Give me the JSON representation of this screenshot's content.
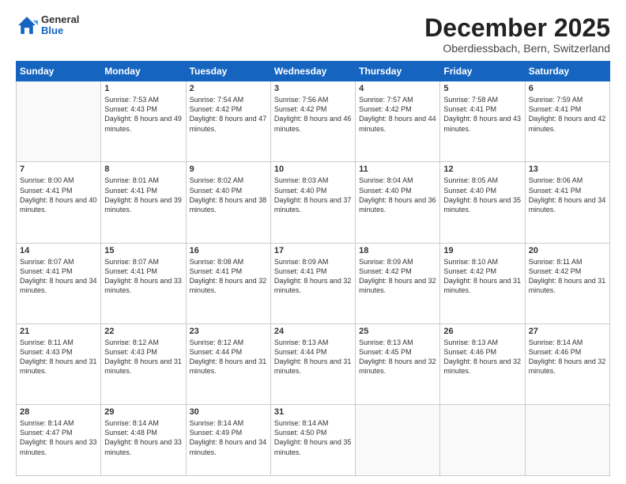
{
  "logo": {
    "general": "General",
    "blue": "Blue"
  },
  "header": {
    "month": "December 2025",
    "location": "Oberdiessbach, Bern, Switzerland"
  },
  "weekdays": [
    "Sunday",
    "Monday",
    "Tuesday",
    "Wednesday",
    "Thursday",
    "Friday",
    "Saturday"
  ],
  "weeks": [
    [
      {
        "day": "",
        "sunrise": "",
        "sunset": "",
        "daylight": ""
      },
      {
        "day": "1",
        "sunrise": "Sunrise: 7:53 AM",
        "sunset": "Sunset: 4:43 PM",
        "daylight": "Daylight: 8 hours and 49 minutes."
      },
      {
        "day": "2",
        "sunrise": "Sunrise: 7:54 AM",
        "sunset": "Sunset: 4:42 PM",
        "daylight": "Daylight: 8 hours and 47 minutes."
      },
      {
        "day": "3",
        "sunrise": "Sunrise: 7:56 AM",
        "sunset": "Sunset: 4:42 PM",
        "daylight": "Daylight: 8 hours and 46 minutes."
      },
      {
        "day": "4",
        "sunrise": "Sunrise: 7:57 AM",
        "sunset": "Sunset: 4:42 PM",
        "daylight": "Daylight: 8 hours and 44 minutes."
      },
      {
        "day": "5",
        "sunrise": "Sunrise: 7:58 AM",
        "sunset": "Sunset: 4:41 PM",
        "daylight": "Daylight: 8 hours and 43 minutes."
      },
      {
        "day": "6",
        "sunrise": "Sunrise: 7:59 AM",
        "sunset": "Sunset: 4:41 PM",
        "daylight": "Daylight: 8 hours and 42 minutes."
      }
    ],
    [
      {
        "day": "7",
        "sunrise": "Sunrise: 8:00 AM",
        "sunset": "Sunset: 4:41 PM",
        "daylight": "Daylight: 8 hours and 40 minutes."
      },
      {
        "day": "8",
        "sunrise": "Sunrise: 8:01 AM",
        "sunset": "Sunset: 4:41 PM",
        "daylight": "Daylight: 8 hours and 39 minutes."
      },
      {
        "day": "9",
        "sunrise": "Sunrise: 8:02 AM",
        "sunset": "Sunset: 4:40 PM",
        "daylight": "Daylight: 8 hours and 38 minutes."
      },
      {
        "day": "10",
        "sunrise": "Sunrise: 8:03 AM",
        "sunset": "Sunset: 4:40 PM",
        "daylight": "Daylight: 8 hours and 37 minutes."
      },
      {
        "day": "11",
        "sunrise": "Sunrise: 8:04 AM",
        "sunset": "Sunset: 4:40 PM",
        "daylight": "Daylight: 8 hours and 36 minutes."
      },
      {
        "day": "12",
        "sunrise": "Sunrise: 8:05 AM",
        "sunset": "Sunset: 4:40 PM",
        "daylight": "Daylight: 8 hours and 35 minutes."
      },
      {
        "day": "13",
        "sunrise": "Sunrise: 8:06 AM",
        "sunset": "Sunset: 4:41 PM",
        "daylight": "Daylight: 8 hours and 34 minutes."
      }
    ],
    [
      {
        "day": "14",
        "sunrise": "Sunrise: 8:07 AM",
        "sunset": "Sunset: 4:41 PM",
        "daylight": "Daylight: 8 hours and 34 minutes."
      },
      {
        "day": "15",
        "sunrise": "Sunrise: 8:07 AM",
        "sunset": "Sunset: 4:41 PM",
        "daylight": "Daylight: 8 hours and 33 minutes."
      },
      {
        "day": "16",
        "sunrise": "Sunrise: 8:08 AM",
        "sunset": "Sunset: 4:41 PM",
        "daylight": "Daylight: 8 hours and 32 minutes."
      },
      {
        "day": "17",
        "sunrise": "Sunrise: 8:09 AM",
        "sunset": "Sunset: 4:41 PM",
        "daylight": "Daylight: 8 hours and 32 minutes."
      },
      {
        "day": "18",
        "sunrise": "Sunrise: 8:09 AM",
        "sunset": "Sunset: 4:42 PM",
        "daylight": "Daylight: 8 hours and 32 minutes."
      },
      {
        "day": "19",
        "sunrise": "Sunrise: 8:10 AM",
        "sunset": "Sunset: 4:42 PM",
        "daylight": "Daylight: 8 hours and 31 minutes."
      },
      {
        "day": "20",
        "sunrise": "Sunrise: 8:11 AM",
        "sunset": "Sunset: 4:42 PM",
        "daylight": "Daylight: 8 hours and 31 minutes."
      }
    ],
    [
      {
        "day": "21",
        "sunrise": "Sunrise: 8:11 AM",
        "sunset": "Sunset: 4:43 PM",
        "daylight": "Daylight: 8 hours and 31 minutes."
      },
      {
        "day": "22",
        "sunrise": "Sunrise: 8:12 AM",
        "sunset": "Sunset: 4:43 PM",
        "daylight": "Daylight: 8 hours and 31 minutes."
      },
      {
        "day": "23",
        "sunrise": "Sunrise: 8:12 AM",
        "sunset": "Sunset: 4:44 PM",
        "daylight": "Daylight: 8 hours and 31 minutes."
      },
      {
        "day": "24",
        "sunrise": "Sunrise: 8:13 AM",
        "sunset": "Sunset: 4:44 PM",
        "daylight": "Daylight: 8 hours and 31 minutes."
      },
      {
        "day": "25",
        "sunrise": "Sunrise: 8:13 AM",
        "sunset": "Sunset: 4:45 PM",
        "daylight": "Daylight: 8 hours and 32 minutes."
      },
      {
        "day": "26",
        "sunrise": "Sunrise: 8:13 AM",
        "sunset": "Sunset: 4:46 PM",
        "daylight": "Daylight: 8 hours and 32 minutes."
      },
      {
        "day": "27",
        "sunrise": "Sunrise: 8:14 AM",
        "sunset": "Sunset: 4:46 PM",
        "daylight": "Daylight: 8 hours and 32 minutes."
      }
    ],
    [
      {
        "day": "28",
        "sunrise": "Sunrise: 8:14 AM",
        "sunset": "Sunset: 4:47 PM",
        "daylight": "Daylight: 8 hours and 33 minutes."
      },
      {
        "day": "29",
        "sunrise": "Sunrise: 8:14 AM",
        "sunset": "Sunset: 4:48 PM",
        "daylight": "Daylight: 8 hours and 33 minutes."
      },
      {
        "day": "30",
        "sunrise": "Sunrise: 8:14 AM",
        "sunset": "Sunset: 4:49 PM",
        "daylight": "Daylight: 8 hours and 34 minutes."
      },
      {
        "day": "31",
        "sunrise": "Sunrise: 8:14 AM",
        "sunset": "Sunset: 4:50 PM",
        "daylight": "Daylight: 8 hours and 35 minutes."
      },
      {
        "day": "",
        "sunrise": "",
        "sunset": "",
        "daylight": ""
      },
      {
        "day": "",
        "sunrise": "",
        "sunset": "",
        "daylight": ""
      },
      {
        "day": "",
        "sunrise": "",
        "sunset": "",
        "daylight": ""
      }
    ]
  ]
}
